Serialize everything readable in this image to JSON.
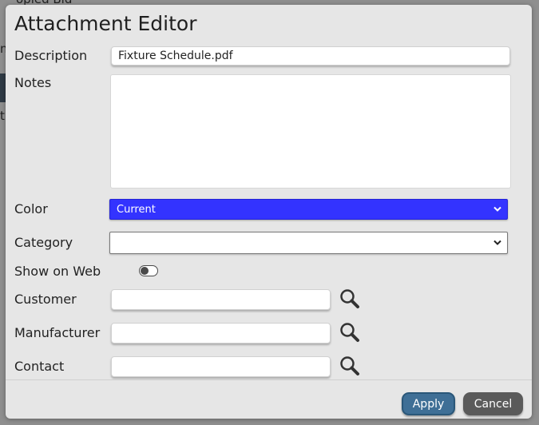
{
  "background": {
    "text_top": "opied Bid",
    "text_side_1": "n",
    "text_side_2": "t"
  },
  "dialog": {
    "title": "Attachment Editor",
    "fields": {
      "description": {
        "label": "Description",
        "value": "Fixture Schedule.pdf"
      },
      "notes": {
        "label": "Notes",
        "value": ""
      },
      "color": {
        "label": "Color",
        "selected": "Current",
        "color": "#3333ff"
      },
      "category": {
        "label": "Category",
        "selected": ""
      },
      "show_on_web": {
        "label": "Show on Web",
        "on": false
      },
      "customer": {
        "label": "Customer",
        "value": ""
      },
      "manufacturer": {
        "label": "Manufacturer",
        "value": ""
      },
      "contact": {
        "label": "Contact",
        "value": ""
      }
    },
    "icons": [
      "search-icon"
    ],
    "buttons": {
      "apply": "Apply",
      "cancel": "Cancel"
    }
  },
  "colors": {
    "apply_button": "#3f6f96",
    "cancel_button": "#5a5a5a",
    "color_select_bg": "#3333ff"
  }
}
